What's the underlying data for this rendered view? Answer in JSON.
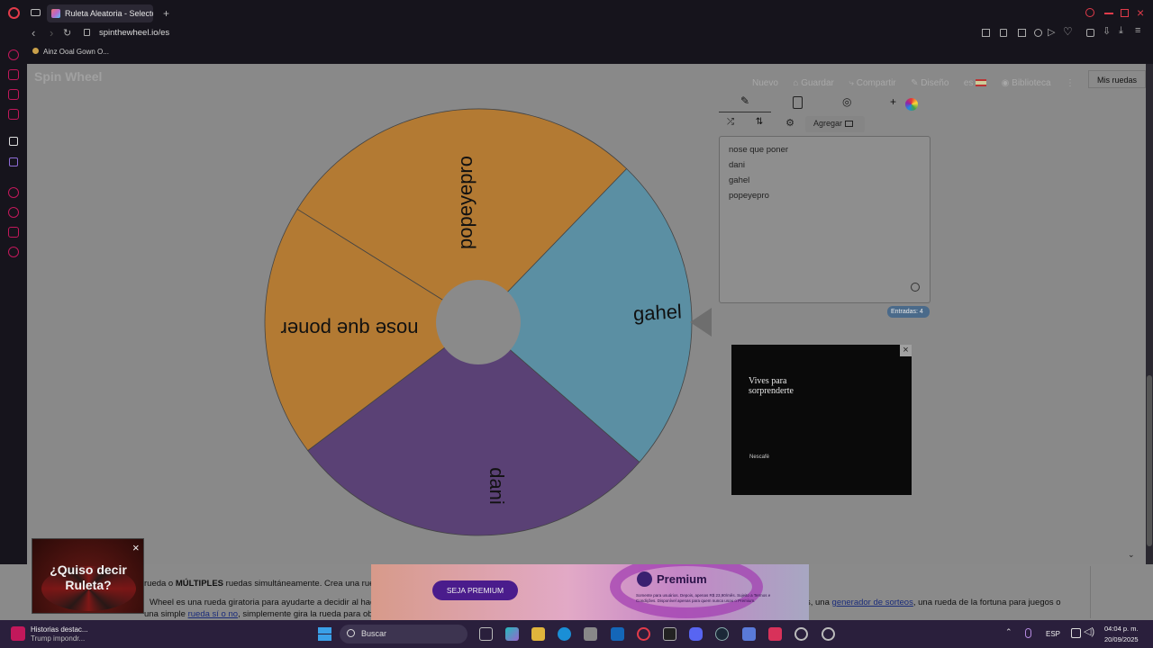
{
  "browser": {
    "tab_title": "Ruleta Aleatoria - Selector",
    "url": "spinthewheel.io/es",
    "bookmark": "Ainz Ooal Gown O..."
  },
  "site": {
    "logo": "Spin Wheel",
    "nav": [
      "Nuevo",
      "Guardar",
      "Compartir",
      "Diseño",
      "es",
      "Biblioteca"
    ],
    "my_wheels": "Mis ruedas"
  },
  "wheel": {
    "segments": [
      {
        "label": "popeyepro",
        "color": "#b37a33"
      },
      {
        "label": "gahel",
        "color": "#5b8fa3"
      },
      {
        "label": "dani",
        "color": "#5a4175"
      },
      {
        "label": "nose que poner",
        "color": "#b37a33"
      }
    ]
  },
  "editor": {
    "add_label": "Agregar",
    "entries": [
      "nose que poner",
      "dani",
      "gahel",
      "popeyepro"
    ],
    "count_label": "Entradas: 4"
  },
  "ad_video": {
    "text": "Vives para sorprenderte",
    "brand": "Nescafé"
  },
  "popup_ad": {
    "text": "¿Quiso decir Ruleta?"
  },
  "bottom_ad": {
    "button": "SEJA PREMIUM",
    "brand": "Premium",
    "fine_print": "Somente para usuários. Depois, apenas R$ 23,90/mês. Sujeito a Termos e Condições. Disponível apenas para quem nunca usou o Premium."
  },
  "page_text": {
    "line1_pre": "rueda o",
    "line1_bold": "MÚLTIPLES",
    "line1_post": "ruedas simultáneamente. Crea una rueda",
    "line2_pre": "Wheel es una rueda giratoria para ayudarte a decidir al hace",
    "line2_post_a": "s, una",
    "line2_link": "generador de sorteos",
    "line2_post_b": ", una rueda de la fortuna para juegos o",
    "line3_a": "una simple",
    "line3_link": "rueda sí o no",
    "line3_b": ", simplemente gira la rueda para obtener lo"
  },
  "taskbar": {
    "news_title": "Historias destac...",
    "news_sub": "Trump impondr...",
    "search": "Buscar",
    "lang": "ESP",
    "time": "04:04 p. m.",
    "date": "20/09/2025"
  }
}
